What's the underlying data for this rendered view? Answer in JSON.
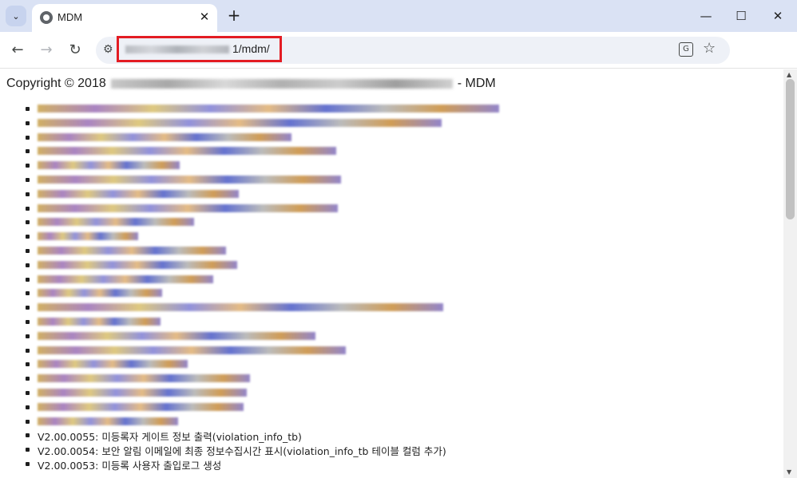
{
  "browser": {
    "tab_title": "MDM",
    "close_glyph": "✕",
    "new_tab_glyph": "+",
    "minimize_glyph": "—",
    "maximize_glyph": "☐",
    "window_close_glyph": "✕",
    "url_visible": "1/mdm/",
    "back_glyph": "←",
    "forward_glyph": "→",
    "reload_glyph": "↻",
    "star_glyph": "☆",
    "tab_search_glyph": "⌄"
  },
  "page": {
    "copyright_prefix": "Copyright © 2018",
    "copyright_suffix": "- MDM",
    "versions_visible": [
      "V2.00.0055: 미등록자 게이트 정보 출력(violation_info_tb)",
      "V2.00.0054: 보안 알림 이메일에 최종 정보수집시간 표시(violation_info_tb 테이블 컬럼 추가)",
      "V2.00.0053: 미등록 사용자 출입로그 생성"
    ],
    "blurred_item_count": 23
  }
}
